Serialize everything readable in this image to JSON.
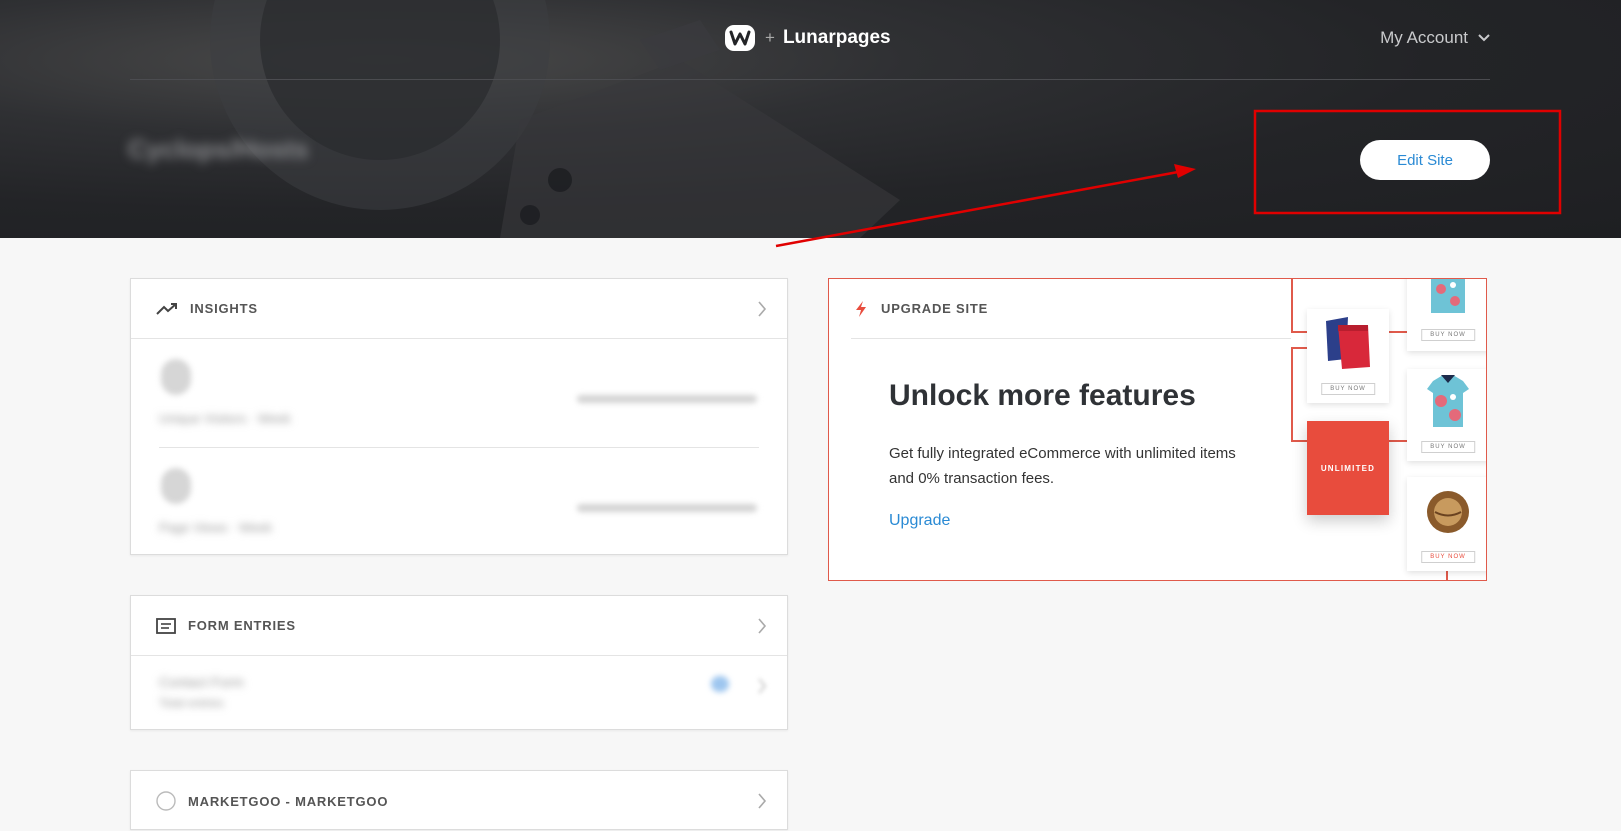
{
  "header": {
    "brand_plus": "+",
    "brand_name": "Lunarpages",
    "account_label": "My Account",
    "site_title": "Cyclops/Hosts",
    "edit_site_label": "Edit Site"
  },
  "icons": {
    "brand": "weebly-logo-icon",
    "account": "chevron-down-icon",
    "insights": "trending-up-icon",
    "form_entries": "form-icon",
    "upgrade": "lightning-icon",
    "marketgoo": "circle-icon",
    "card_chevron": "chevron-right-icon"
  },
  "colors": {
    "hero_bg": "#232427",
    "link_blue": "#2a8ad4",
    "accent_red": "#e84c3d",
    "annotation_red": "#e00000"
  },
  "insights": {
    "title": "INSIGHTS",
    "rows": [
      {
        "label": "Unique Visitors · Week"
      },
      {
        "label": "Page Views · Week"
      }
    ]
  },
  "form_entries": {
    "title": "FORM ENTRIES",
    "form_name": "Contact Form",
    "form_sub": "Total entries"
  },
  "marketgoo": {
    "title": "MARKETGOO - MARKETGOO"
  },
  "upgrade": {
    "title": "UPGRADE SITE",
    "heading": "Unlock more features",
    "body": "Get fully integrated eCommerce with unlimited items and 0% transaction fees.",
    "link": "Upgrade",
    "promo_badge": "UNLIMITED",
    "buy_now": "BUY NOW"
  }
}
